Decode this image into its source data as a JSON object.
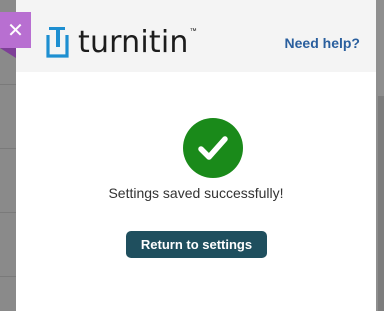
{
  "header": {
    "brand": "turnitin",
    "trademark": "™",
    "help_link": "Need help?"
  },
  "close_button": {
    "label": "✕"
  },
  "main": {
    "status_icon": "check-circle-icon",
    "message": "Settings saved successfully!",
    "return_button": "Return to settings"
  },
  "colors": {
    "brand_blue": "#1e8fd1",
    "help_link": "#2a5f9e",
    "success_green": "#1a8a1a",
    "button_bg": "#1f4f5e",
    "close_tab": "#b86fd1"
  }
}
